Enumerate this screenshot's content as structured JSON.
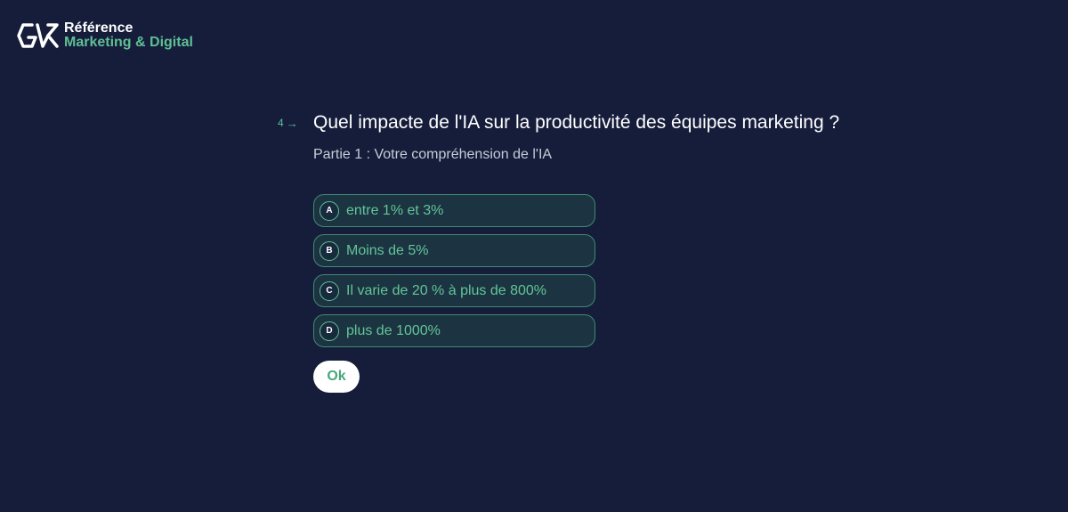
{
  "brand": {
    "line1": "Référence",
    "line2": "Marketing & Digital",
    "accent_color": "#5fbf94",
    "background_color": "#151d3b"
  },
  "question": {
    "number": "4",
    "arrow_icon": "arrow-right-icon",
    "title": "Quel impacte de l'IA sur la productivité des équipes marketing ?",
    "subtitle": "Partie 1 : Votre compréhension de l'IA"
  },
  "options": [
    {
      "key": "A",
      "label": "entre 1% et 3%"
    },
    {
      "key": "B",
      "label": "Moins de 5%"
    },
    {
      "key": "C",
      "label": "Il varie de 20 % à plus de 800%"
    },
    {
      "key": "D",
      "label": "plus de 1000%"
    }
  ],
  "submit": {
    "label": "Ok"
  }
}
